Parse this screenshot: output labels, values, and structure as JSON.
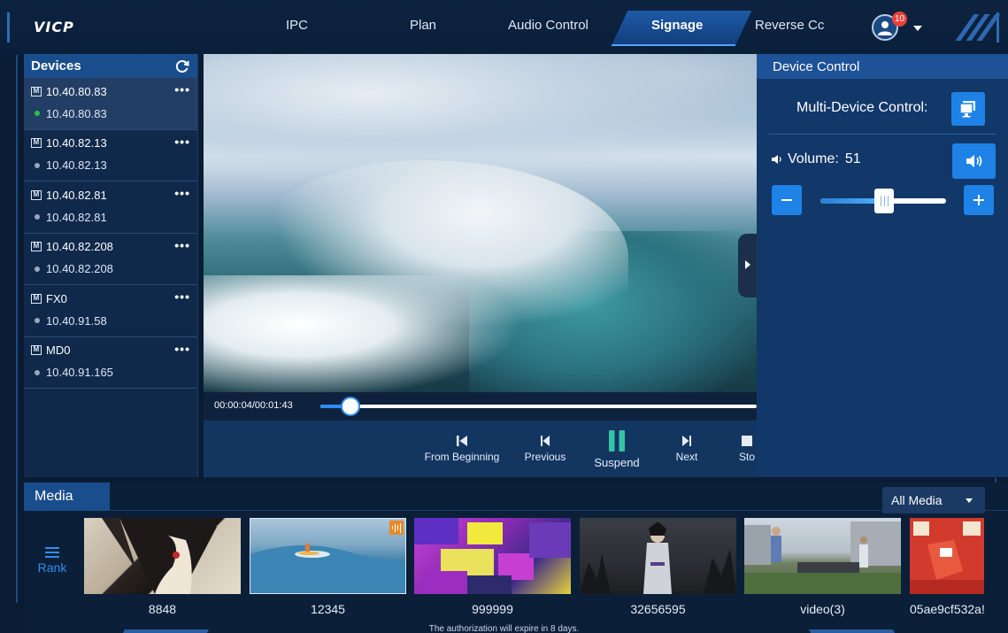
{
  "app": {
    "logo": "VICP"
  },
  "nav": {
    "items": [
      {
        "label": "IPC"
      },
      {
        "label": "Plan"
      },
      {
        "label": "Audio Control"
      },
      {
        "label": "Signage",
        "active": true
      },
      {
        "label": "Reverse Cc"
      }
    ],
    "notifications": "10",
    "icons": {
      "user": "user-avatar-icon",
      "dropdown": "chevron-down-icon"
    }
  },
  "devices": {
    "title": "Devices",
    "refresh_icon": "refresh-icon",
    "items": [
      {
        "name": "10.40.80.83",
        "ip": "10.40.80.83",
        "status": "online",
        "selected": true
      },
      {
        "name": "10.40.82.13",
        "ip": "10.40.82.13",
        "status": "offline"
      },
      {
        "name": "10.40.82.81",
        "ip": "10.40.82.81",
        "status": "offline"
      },
      {
        "name": "10.40.82.208",
        "ip": "10.40.82.208",
        "status": "offline"
      },
      {
        "name": "FX0",
        "ip": "10.40.91.58",
        "status": "offline"
      },
      {
        "name": "MD0",
        "ip": "10.40.91.165",
        "status": "offline"
      }
    ],
    "more_label": "•••"
  },
  "player": {
    "time": "00:00:04/00:01:43",
    "progress_fraction": 0.04,
    "controls": [
      {
        "label": "From Beginning",
        "icon": "skip-to-start-icon"
      },
      {
        "label": "Previous",
        "icon": "previous-icon"
      },
      {
        "label": "Suspend",
        "icon": "pause-icon"
      },
      {
        "label": "Next",
        "icon": "next-icon"
      },
      {
        "label": "Sto",
        "icon": "stop-icon"
      }
    ]
  },
  "device_control": {
    "title": "Device Control",
    "multi_label": "Multi-Device Control:",
    "volume_label": "Volume:",
    "volume_value": "51",
    "volume_level": 0.51
  },
  "media": {
    "tab": "Media",
    "filter": "All Media",
    "rank_label": "Rank",
    "items": [
      {
        "label": "8848"
      },
      {
        "label": "12345",
        "selected": true,
        "audio": true
      },
      {
        "label": "999999"
      },
      {
        "label": "32656595"
      },
      {
        "label": "video(3)"
      },
      {
        "label": "05ae9cf532a!"
      }
    ]
  },
  "footer": {
    "note": "The authorization will expire in 8 days."
  },
  "colors": {
    "accent": "#1e82e6",
    "online": "#27c04b",
    "offline": "#9aa8ba",
    "panel": "#12386a"
  }
}
